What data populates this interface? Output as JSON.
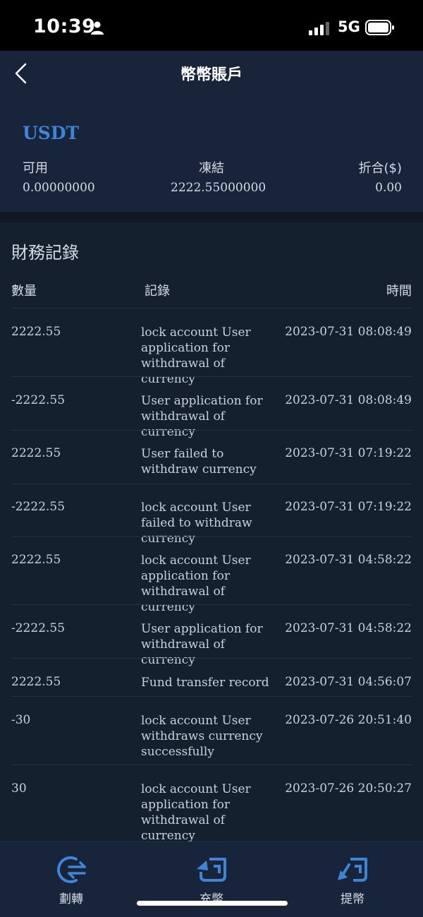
{
  "status_bar": {
    "time": "10:39",
    "network": "5G"
  },
  "nav": {
    "title": "幣幣賬戶"
  },
  "asset": {
    "coin": "USDT",
    "available_label": "可用",
    "frozen_label": "凍結",
    "converted_label": "折合($)",
    "available_value": "0.00000000",
    "frozen_value": "2222.55000000",
    "converted_value": "0.00"
  },
  "records": {
    "title": "財務記錄",
    "columns": {
      "quantity": "數量",
      "record": "記錄",
      "time": "時間"
    },
    "rows": [
      {
        "quantity": "2222.55",
        "record": "lock account User application for withdrawal of currency",
        "time": "2023-07-31 08:08:49"
      },
      {
        "quantity": "-2222.55",
        "record": "User application for withdrawal of currency",
        "time": "2023-07-31 08:08:49"
      },
      {
        "quantity": "2222.55",
        "record": "User failed to withdraw currency",
        "time": "2023-07-31 07:19:22"
      },
      {
        "quantity": "-2222.55",
        "record": "lock account User failed to withdraw currency",
        "time": "2023-07-31 07:19:22"
      },
      {
        "quantity": "2222.55",
        "record": "lock account User application for withdrawal of currency",
        "time": "2023-07-31 04:58:22"
      },
      {
        "quantity": "-2222.55",
        "record": "User application for withdrawal of currency",
        "time": "2023-07-31 04:58:22"
      },
      {
        "quantity": "2222.55",
        "record": "Fund transfer record",
        "time": "2023-07-31 04:56:07"
      },
      {
        "quantity": "-30",
        "record": "lock account User withdraws currency successfully",
        "time": "2023-07-26 20:51:40"
      },
      {
        "quantity": "30",
        "record": "lock account User application for withdrawal of currency",
        "time": "2023-07-26 20:50:27"
      }
    ]
  },
  "tabbar": {
    "transfer_label": "劃轉",
    "deposit_label": "充幣",
    "withdraw_label": "提幣"
  },
  "colors": {
    "accent": "#3f84d6",
    "background": "#15202f",
    "card": "#18243a"
  }
}
